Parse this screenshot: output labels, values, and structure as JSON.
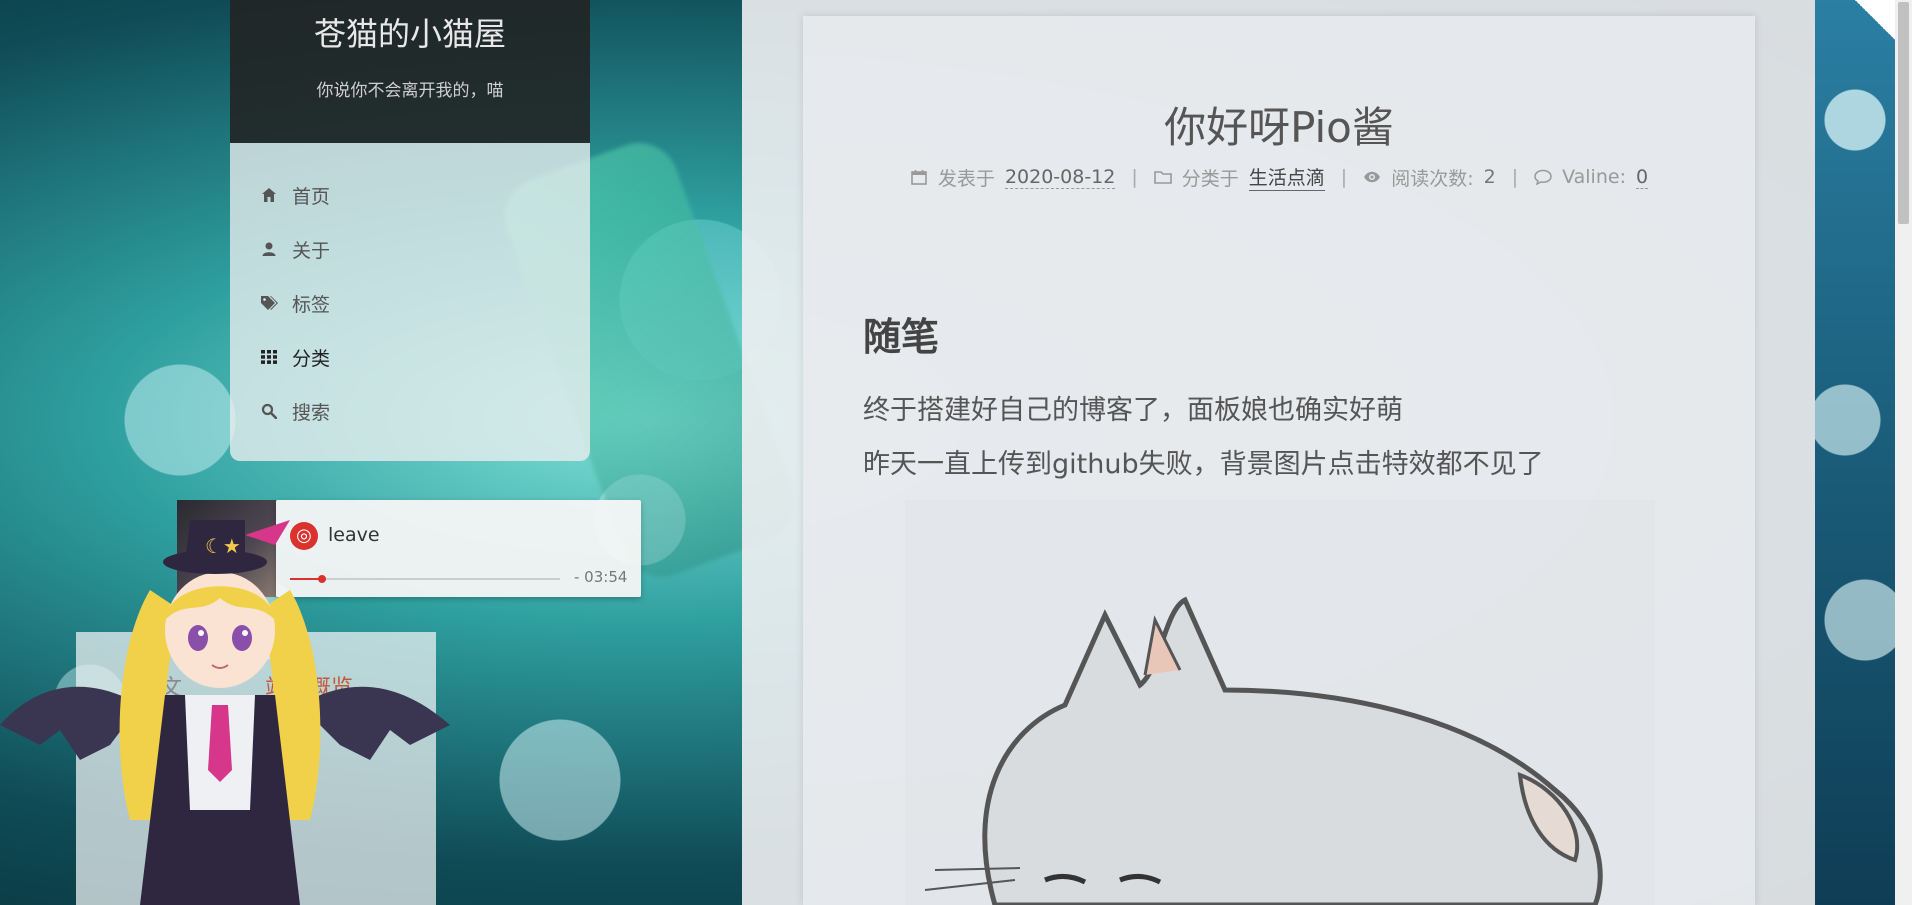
{
  "site": {
    "title": "苍猫的小猫屋",
    "subtitle": "你说你不会离开我的，喵"
  },
  "menu": {
    "items": [
      {
        "label": "首页",
        "icon": "home-icon"
      },
      {
        "label": "关于",
        "icon": "user-icon"
      },
      {
        "label": "标签",
        "icon": "tags-icon"
      },
      {
        "label": "分类",
        "icon": "grid-icon"
      },
      {
        "label": "搜索",
        "icon": "search-icon"
      }
    ]
  },
  "player": {
    "song": "leave",
    "time": "- 03:54",
    "progress": 0.12,
    "accent": "#d9322f"
  },
  "sidebar_panel": {
    "tab_left": "文",
    "tab_active": "站点概览"
  },
  "post": {
    "title": "你好呀Pio酱",
    "meta": {
      "posted_label": "发表于",
      "posted_date": "2020-08-12",
      "category_label": "分类于",
      "category": "生活点滴",
      "views_label": "阅读次数:",
      "views": "2",
      "comments_label": "Valine:",
      "comments": "0"
    },
    "heading": "随笔",
    "paragraphs": [
      "终于搭建好自己的博客了，面板娘也确实好萌",
      "昨天一直上传到github失败，背景图片点击特效都不见了"
    ]
  }
}
